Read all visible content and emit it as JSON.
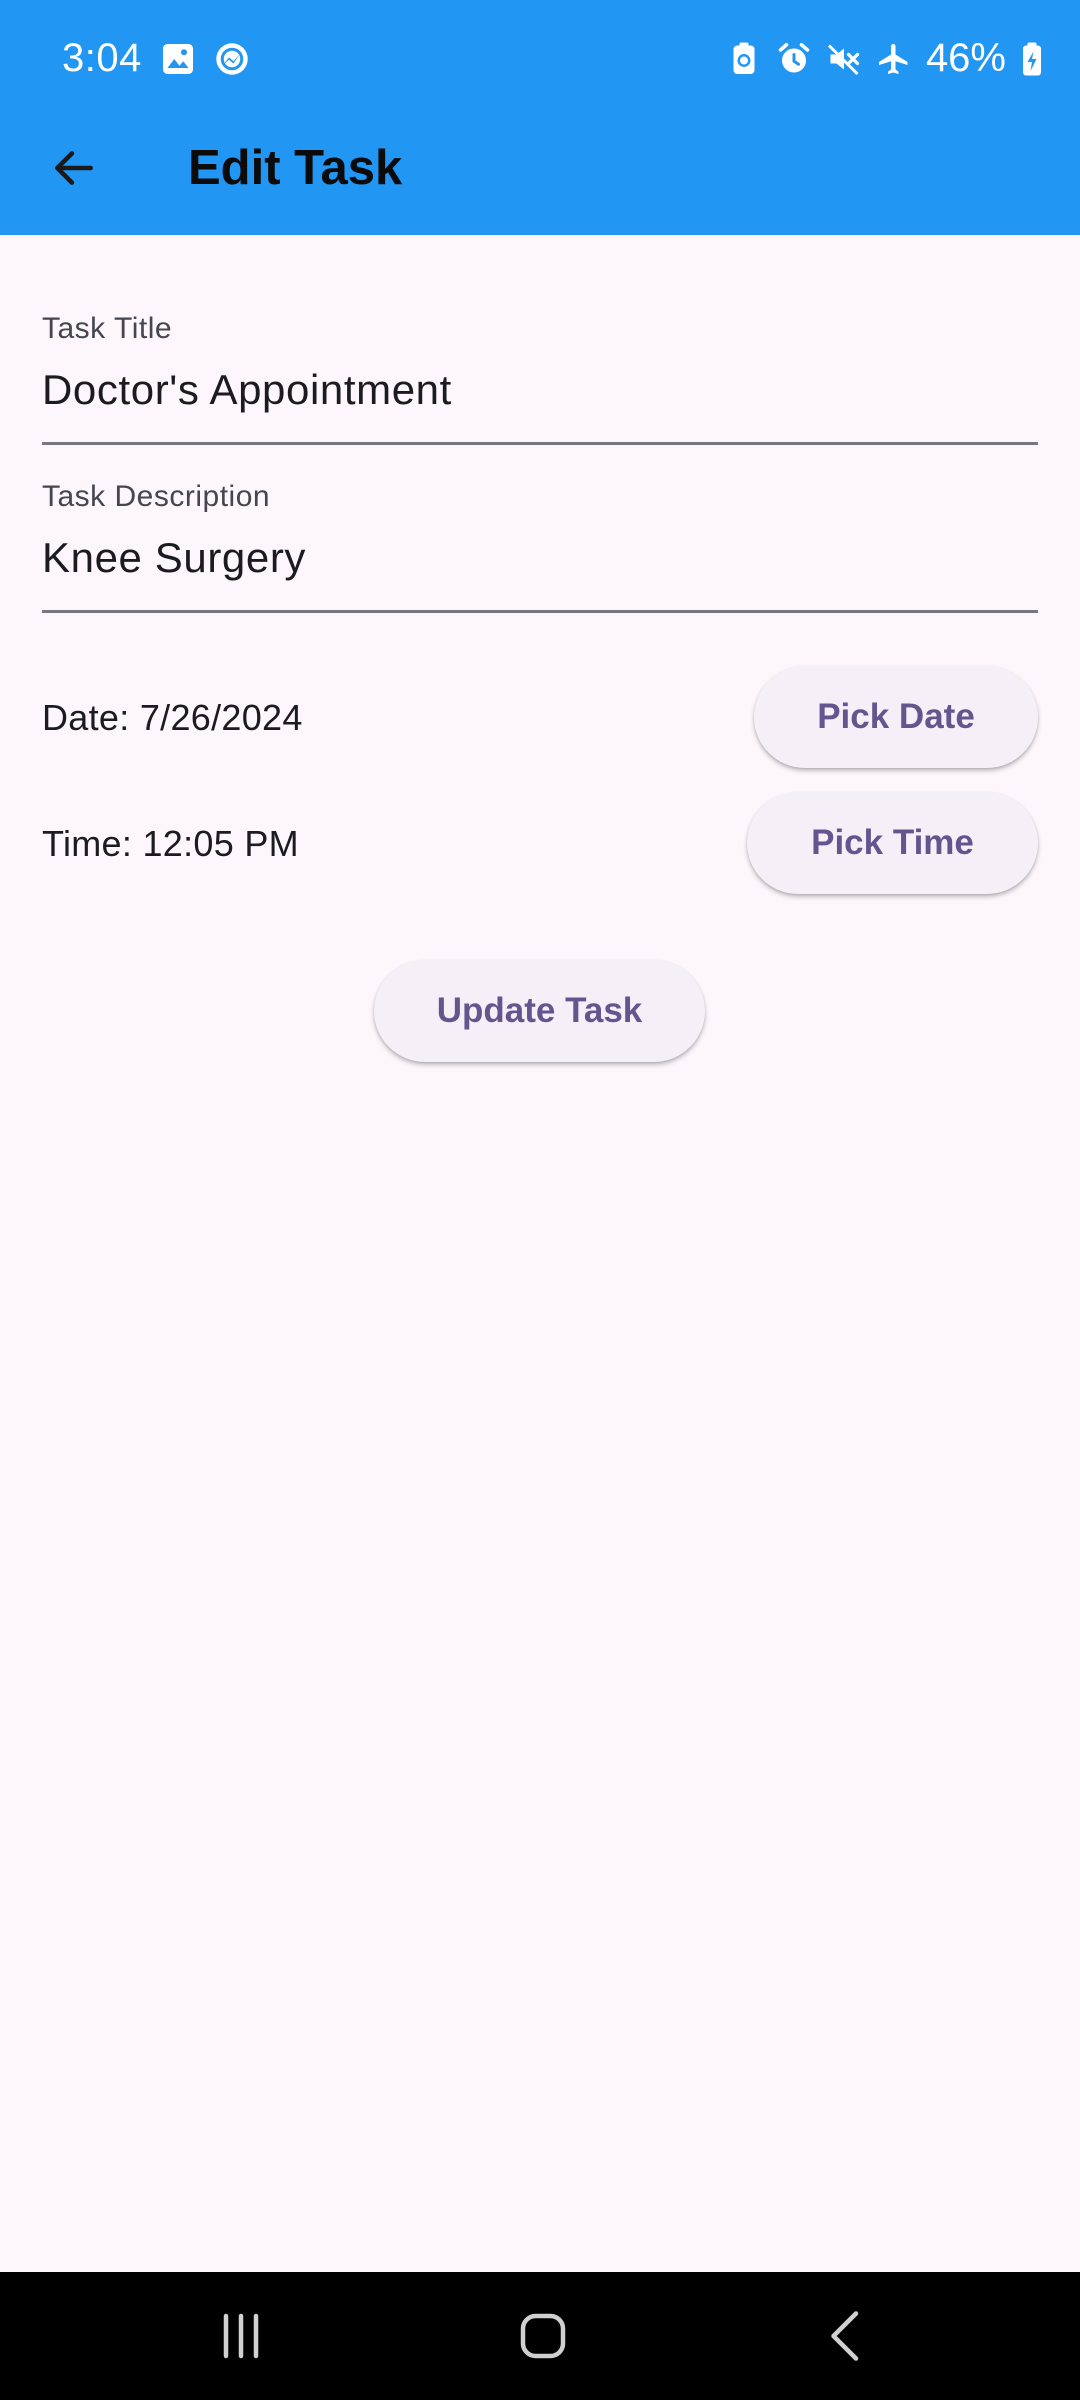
{
  "status_bar": {
    "time": "3:04",
    "battery_percent": "46%",
    "left_icons": [
      "gallery-icon",
      "messenger-icon"
    ],
    "right_icons": [
      "battery-saver-icon",
      "alarm-icon",
      "mute-icon",
      "airplane-icon",
      "battery-icon"
    ]
  },
  "app_bar": {
    "title": "Edit Task",
    "color": "#2196f3"
  },
  "form": {
    "title_field": {
      "label": "Task Title",
      "value": "Doctor's Appointment"
    },
    "description_field": {
      "label": "Task Description",
      "value": "Knee Surgery"
    },
    "date_text": "Date: 7/26/2024",
    "time_text": "Time: 12:05 PM",
    "pick_date_label": "Pick Date",
    "pick_time_label": "Pick Time",
    "update_label": "Update Task"
  },
  "nav_bar": {
    "buttons": [
      "recents-icon",
      "home-icon",
      "back-icon"
    ]
  },
  "colors": {
    "accent_text": "#65558f",
    "button_bg": "#f5eff7",
    "page_bg": "#fdf7fc"
  }
}
